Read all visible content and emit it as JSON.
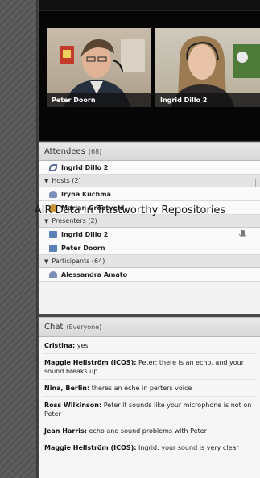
{
  "videos": [
    {
      "name": "Peter Doorn"
    },
    {
      "name": "Ingrid Dillo 2"
    }
  ],
  "attendees": {
    "title": "Attendees",
    "count": "(68)",
    "speaker": "Ingrid Dillo 2",
    "sections": [
      {
        "label": "Hosts (2)",
        "members": [
          "Iryna Kuchma",
          "Marjan Grootveld"
        ]
      },
      {
        "label": "Presenters (2)",
        "members": [
          "Ingrid Dillo 2",
          "Peter Doorn"
        ]
      },
      {
        "label": "Participants (64)",
        "members": [
          "Alessandra Amato"
        ]
      }
    ]
  },
  "overlay": {
    "text": "AIR Data in Trustworthy Repositories"
  },
  "chat": {
    "title": "Chat",
    "scope": "(Everyone)",
    "messages": [
      {
        "sender": "Cristina:",
        "text": " yes"
      },
      {
        "sender": "Maggie Hellström (ICOS):",
        "text": " Peter: there is an echo, and your sound breaks up"
      },
      {
        "sender": "Nina, Berlin:",
        "text": " theres an eche in perters voice"
      },
      {
        "sender": "Ross Wilkinson:",
        "text": " Peter it sounds like your microphone is not on Peter -"
      },
      {
        "sender": "Jean Harris:",
        "text": " echo and sound problems with Peter"
      },
      {
        "sender": "Maggie Hellström (ICOS):",
        "text": " Ingrid: your sound is very clear"
      }
    ]
  },
  "icons": {
    "speaker": "phone-icon",
    "host": "user-icon",
    "presenter": "presenter-icon",
    "participant": "user-icon",
    "active_mic": "microphone-icon"
  }
}
